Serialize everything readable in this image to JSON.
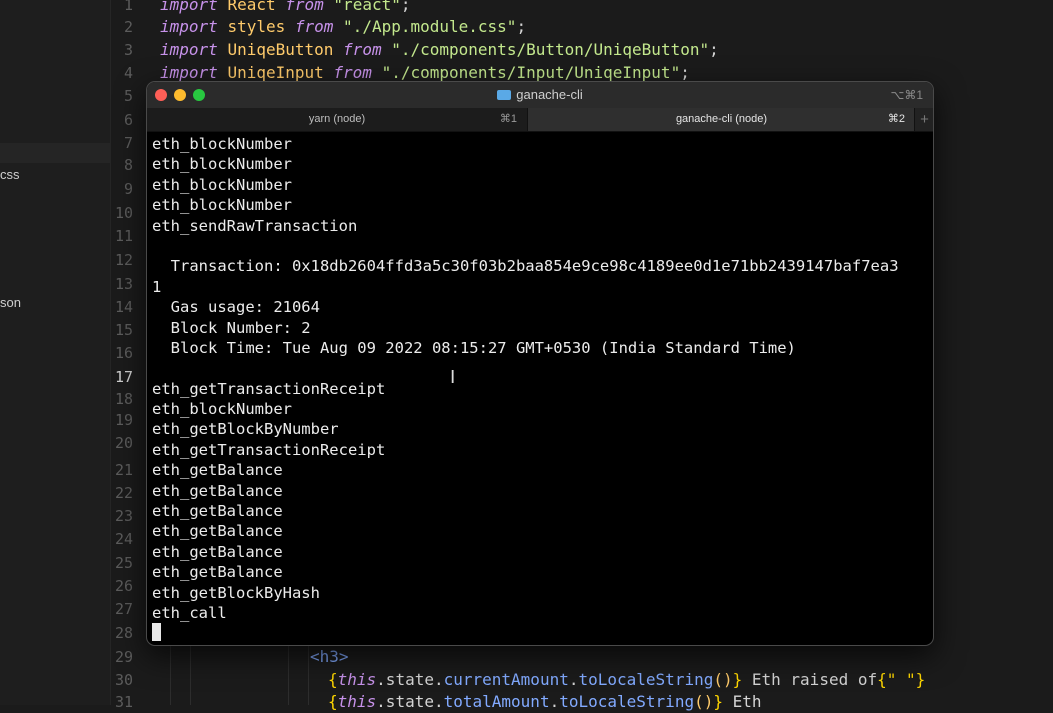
{
  "sidebar": {
    "items": [
      {
        "label": "css"
      },
      {
        "label": "son"
      }
    ]
  },
  "editor": {
    "line_numbers": [
      "1",
      "2",
      "3",
      "4",
      "5",
      "6",
      "7",
      "8",
      "9",
      "10",
      "11",
      "12",
      "13",
      "14",
      "15",
      "16",
      "17",
      "18",
      "19",
      "20",
      "21",
      "22",
      "23",
      "24",
      "25",
      "26",
      "27",
      "28",
      "29",
      "30",
      "31"
    ],
    "current_line": "17",
    "top_lines": [
      {
        "kw": "import",
        "id": "React",
        "from": "from",
        "str": "\"react\"",
        "end": ";"
      },
      {
        "kw": "import",
        "id": "styles",
        "from": "from",
        "str": "\"./App.module.css\"",
        "end": ";"
      },
      {
        "kw": "import",
        "id": "UniqeButton",
        "from": "from",
        "str": "\"./components/Button/UniqeButton\"",
        "end": ";"
      },
      {
        "kw": "import",
        "id": "UniqeInput",
        "from": "from",
        "str": "\"./components/Input/UniqeInput\"",
        "end": ";"
      }
    ],
    "bottom_lines": {
      "line29_tag": "<h3>",
      "line30_open": "{",
      "line30_this": "this",
      "line30_state": ".state.",
      "line30_prop": "currentAmount",
      "line30_dot": ".",
      "line30_fn": "toLocaleString",
      "line30_call": "()",
      "line30_close": "}",
      "line30_text": " Eth raised of",
      "line30_str": "{\" \"}",
      "line31_open": "{",
      "line31_this": "this",
      "line31_state": ".state.",
      "line31_prop": "totalAmount",
      "line31_dot": ".",
      "line31_fn": "toLocaleString",
      "line31_call": "()",
      "line31_close": "}",
      "line31_text": " Eth"
    }
  },
  "terminal": {
    "title": "ganache-cli",
    "shortcut": "⌥⌘1",
    "tabs": [
      {
        "label": "yarn (node)",
        "key": "⌘1"
      },
      {
        "label": "ganache-cli (node)",
        "key": "⌘2"
      }
    ],
    "new_tab": "+",
    "lines": [
      "eth_blockNumber",
      "eth_blockNumber",
      "eth_blockNumber",
      "eth_blockNumber",
      "eth_sendRawTransaction",
      "",
      "  Transaction: 0x18db2604ffd3a5c30f03b2baa854e9ce98c4189ee0d1e71bb2439147baf7ea3",
      "1",
      "  Gas usage: 21064",
      "  Block Number: 2",
      "  Block Time: Tue Aug 09 2022 08:15:27 GMT+0530 (India Standard Time)",
      "",
      "eth_getTransactionReceipt",
      "eth_blockNumber",
      "eth_getBlockByNumber",
      "eth_getTransactionReceipt",
      "eth_getBalance",
      "eth_getBalance",
      "eth_getBalance",
      "eth_getBalance",
      "eth_getBalance",
      "eth_getBalance",
      "eth_getBlockByHash",
      "eth_call"
    ],
    "colors": {
      "close": "#ff5f57",
      "minimize": "#febc2e",
      "zoom": "#28c840"
    }
  }
}
